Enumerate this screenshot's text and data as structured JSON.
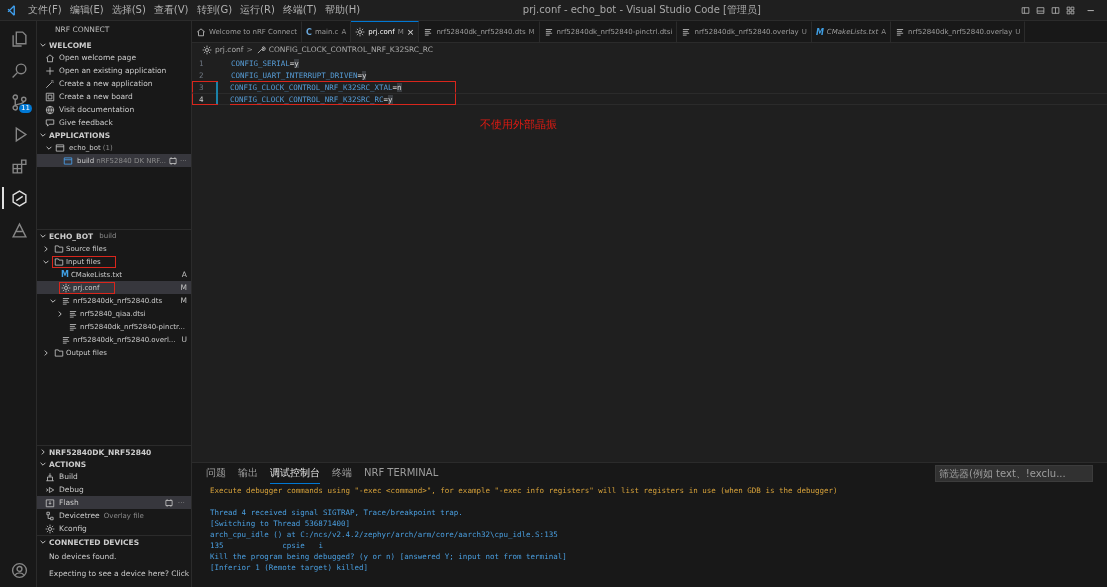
{
  "title_bar": {
    "menu": [
      "文件(F)",
      "编辑(E)",
      "选择(S)",
      "查看(V)",
      "转到(G)",
      "运行(R)",
      "终端(T)",
      "帮助(H)"
    ],
    "title": "prj.conf - echo_bot - Visual Studio Code [管理员]",
    "minimize": "−"
  },
  "activity_bar": [
    {
      "selected": false
    },
    {
      "selected": false
    },
    {
      "selected": false,
      "badge": "11"
    },
    {
      "selected": false
    },
    {
      "selected": false
    },
    {
      "selected": true
    },
    {
      "selected": false
    }
  ],
  "sidebar": {
    "title": "NRF CONNECT",
    "welcome": {
      "header": "WELCOME",
      "expanded": true,
      "items": [
        "Open welcome page",
        "Open an existing application",
        "Create a new application",
        "Create a new board",
        "Visit documentation",
        "Give feedback"
      ]
    },
    "applications": {
      "header": "APPLICATIONS",
      "expanded": true,
      "app": {
        "label": "echo_bot",
        "count": "(1)",
        "expanded": true
      },
      "build": {
        "label": "build",
        "detail": "nRF52840 DK NRF...",
        "more": "···",
        "selected": true
      }
    },
    "project": {
      "header": "ECHO_BOT",
      "detail": "build",
      "expanded": true,
      "tree": [
        {
          "kind": "folder",
          "label": "Source files",
          "expanded": false,
          "selected": false,
          "boxed": false
        },
        {
          "kind": "folder",
          "label": "Input files",
          "expanded": true,
          "selected": false,
          "boxed": true,
          "children": [
            {
              "kind": "cmake",
              "icon_text": "M",
              "label": "CMakeLists.txt",
              "status": "A",
              "selected": false,
              "boxed": false
            },
            {
              "kind": "config",
              "label": "prj.conf",
              "status": "M",
              "selected": true,
              "boxed": true
            },
            {
              "kind": "devicetree",
              "label": "nrf52840dk_nrf52840.dts",
              "status": "M",
              "expanded": true,
              "selected": false,
              "boxed": false,
              "children": [
                {
                  "kind": "devicetree",
                  "label": "nrf52840_qiaa.dtsi",
                  "expanded": false,
                  "selected": false,
                  "boxed": false
                },
                {
                  "kind": "devicetree",
                  "label": "nrf52840dk_nrf52840-pinctr...",
                  "selected": false,
                  "boxed": false
                }
              ]
            },
            {
              "kind": "devicetree",
              "label": "nrf52840dk_nrf52840.overl...",
              "status": "U",
              "selected": false,
              "boxed": false
            }
          ]
        },
        {
          "kind": "folder",
          "label": "Output files",
          "expanded": false,
          "selected": false,
          "boxed": false
        }
      ]
    },
    "board": {
      "header": "NRF52840DK_NRF52840",
      "expanded": false
    },
    "actions": {
      "header": "ACTIONS",
      "expanded": true,
      "items": [
        {
          "label": "Build",
          "selected": false
        },
        {
          "label": "Debug",
          "selected": false
        },
        {
          "label": "Flash",
          "selected": true,
          "more": "···"
        },
        {
          "label": "Devicetree",
          "detail": "Overlay file",
          "selected": false
        },
        {
          "label": "Kconfig",
          "selected": false
        }
      ]
    },
    "devices": {
      "header": "CONNECTED DEVICES",
      "expanded": true,
      "messages": [
        "No devices found.",
        "Expecting to see a device here? Click"
      ]
    }
  },
  "editor": {
    "tabs": [
      {
        "label": "Welcome to nRF Connect",
        "kind": "welcome",
        "selected": false,
        "preview": false
      },
      {
        "label": "main.c",
        "kind": "c",
        "icon_text": "C",
        "status": "A",
        "selected": false,
        "preview": false
      },
      {
        "label": "prj.conf",
        "kind": "config",
        "status": "M",
        "selected": true,
        "preview": false,
        "close": "×"
      },
      {
        "label": "nrf52840dk_nrf52840.dts",
        "kind": "devicetree",
        "status": "M",
        "selected": false,
        "preview": false
      },
      {
        "label": "nrf52840dk_nrf52840-pinctrl.dtsi",
        "kind": "devicetree",
        "selected": false,
        "preview": false
      },
      {
        "label": "nrf52840dk_nrf52840.overlay",
        "kind": "devicetree",
        "status": "U",
        "selected": false,
        "preview": false
      },
      {
        "label": "CMakeLists.txt",
        "kind": "cmake",
        "icon_text": "M",
        "status": "A",
        "selected": false,
        "preview": true
      },
      {
        "label": "nrf52840dk_nrf52840.overlay",
        "kind": "devicetree",
        "status": "U",
        "selected": false,
        "preview": false
      }
    ],
    "breadcrumb": [
      "prj.conf",
      "CONFIG_CLOCK_CONTROL_NRF_K32SRC_RC"
    ],
    "breadcrumb_separator": ">",
    "lines": [
      {
        "number": "1",
        "key": "CONFIG_SERIAL",
        "operator": "=",
        "value": "y",
        "modified": false,
        "current": false,
        "boxed": false
      },
      {
        "number": "2",
        "key": "CONFIG_UART_INTERRUPT_DRIVEN",
        "operator": "=",
        "value": "y",
        "modified": false,
        "current": false,
        "boxed": false
      },
      {
        "number": "3",
        "key": "CONFIG_CLOCK_CONTROL_NRF_K32SRC_XTAL",
        "operator": "=",
        "value": "n",
        "modified": true,
        "current": false,
        "boxed": true
      },
      {
        "number": "4",
        "key": "CONFIG_CLOCK_CONTROL_NRF_K32SRC_RC",
        "operator": "=",
        "value": "y",
        "modified": true,
        "current": true,
        "boxed": true
      }
    ],
    "note": "不使用外部晶振"
  },
  "panel": {
    "tabs": [
      {
        "label": "问题",
        "selected": false
      },
      {
        "label": "输出",
        "selected": false
      },
      {
        "label": "调试控制台",
        "selected": true
      },
      {
        "label": "终端",
        "selected": false
      },
      {
        "label": "NRF TERMINAL",
        "selected": false
      }
    ],
    "filter": {
      "placeholder": "筛选器(例如 text、!exclu..."
    },
    "output": [
      {
        "kind": "command",
        "text": "Execute debugger commands using \"-exec <command>\", for example \"-exec info registers\" will list registers in use (when GDB is the debugger)"
      },
      {
        "kind": "blank"
      },
      {
        "kind": "info",
        "text": "Thread 4 received signal SIGTRAP, Trace/breakpoint trap."
      },
      {
        "kind": "info",
        "text": "[Switching to Thread 536871400]"
      },
      {
        "kind": "info",
        "text": "arch_cpu_idle () at C:/ncs/v2.4.2/zephyr/arch/arm/core/aarch32\\cpu_idle.S:135"
      },
      {
        "kind": "info",
        "text": "135\t\tcpsie\ti"
      },
      {
        "kind": "info",
        "text": "Kill the program being debugged? (y or n) [answered Y; input not from terminal]"
      },
      {
        "kind": "info",
        "text": "[Inferior 1 (Remote target) killed]"
      }
    ]
  }
}
